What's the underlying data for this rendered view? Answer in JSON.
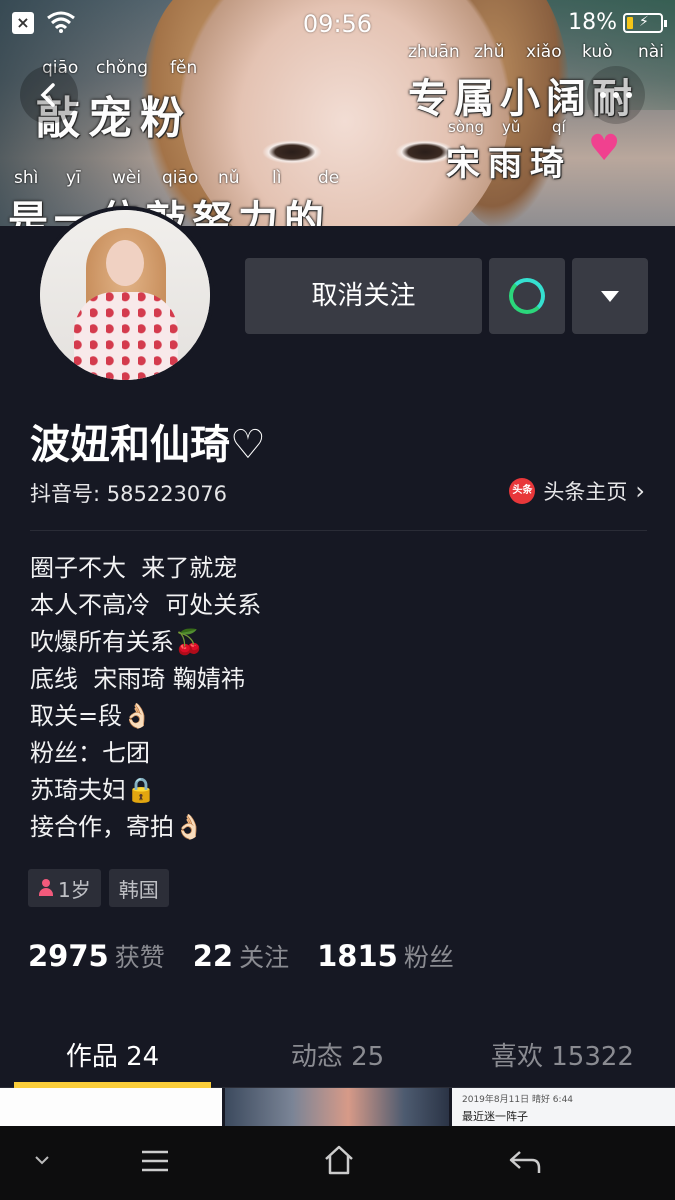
{
  "status_bar": {
    "time": "09:56",
    "battery_percent": "18%",
    "battery_level": 0.18
  },
  "cover": {
    "overlay_lines": [
      {
        "pinyin": [
          "qiāo",
          "chǒng",
          "fěn"
        ],
        "text": "敲宠粉"
      },
      {
        "pinyin": [
          "zhuān",
          "zhǔ",
          "xiǎo",
          "kuò",
          "nài"
        ],
        "text": "专属小阔耐"
      },
      {
        "pinyin": [
          "sòng",
          "yǔ",
          "qí"
        ],
        "text": "宋雨琦"
      },
      {
        "pinyin": [
          "shì",
          "yī",
          "wèi",
          "qiāo",
          "nǔ",
          "lì",
          "de"
        ],
        "text": "是一位敲努力的"
      }
    ]
  },
  "actions": {
    "unfollow_label": "取消关注"
  },
  "profile": {
    "nickname": "波妞和仙琦♡",
    "douyin_id": "抖音号: 585223076",
    "toutiao_badge": "头条",
    "toutiao_label": "头条主页",
    "bio_lines": [
      "圈子不大  来了就宠",
      "本人不高冷  可处关系",
      "吹爆所有关系🍒",
      "底线  宋雨琦 鞠婧祎",
      "取关=段👌🏻",
      "粉丝：七团",
      "苏琦夫妇🔒",
      "接合作，寄拍👌🏻"
    ],
    "tags": {
      "age": "1岁",
      "region": "韩国"
    },
    "stats": [
      {
        "num": "2975",
        "label": "获赞"
      },
      {
        "num": "22",
        "label": "关注"
      },
      {
        "num": "1815",
        "label": "粉丝"
      }
    ]
  },
  "tabs": [
    {
      "label": "作品 24",
      "active": true
    },
    {
      "label": "动态 25",
      "active": false
    },
    {
      "label": "喜欢 15322",
      "active": false
    }
  ],
  "thumbs": {
    "third_date": "2019年8月11日  晴好 6:44",
    "third_text": "最近迷一阵子"
  },
  "colors": {
    "background": "#161823",
    "button_bg": "#393b44",
    "accent_tab": "#facd3a",
    "toutiao_red": "#e8373a"
  }
}
